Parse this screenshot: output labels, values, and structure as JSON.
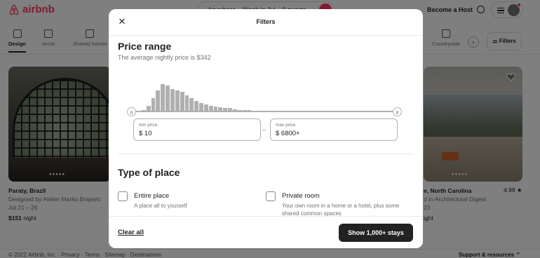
{
  "header": {
    "logo_text": "airbnb",
    "search": {
      "anywhere": "Anywhere",
      "week": "Week in Jul",
      "guests": "2 guests"
    },
    "become_host": "Become a Host",
    "brand_color": "#ff385c"
  },
  "categories": {
    "items": [
      {
        "label": "Design",
        "icon": "design-icon",
        "active": true
      },
      {
        "label": "Arctic",
        "icon": "snowflake-icon",
        "active": false
      },
      {
        "label": "Shared homes",
        "icon": "house-icon",
        "active": false
      },
      {
        "label": "Countryside",
        "icon": "tree-icon",
        "active": false
      }
    ],
    "filters_label": "Filters"
  },
  "listings": [
    {
      "title": "Paraty, Brazil",
      "subtitle": "Designed by Atelier Marko Brajovic",
      "dates": "Jul 21 – 26",
      "price": "$151",
      "price_unit": "night"
    },
    {
      "title": "e, North Carolina",
      "subtitle": "d in Architectural Digest",
      "dates": "23",
      "price_unit": "ight",
      "rating": "4.99 ★"
    }
  ],
  "footer": {
    "left": "© 2022 Airbnb, Inc.  ·  Privacy  ·  Terms  ·  Sitemap  ·  Destinations",
    "right": "Support & resources ⌃"
  },
  "modal": {
    "title": "Filters",
    "price_range": {
      "heading": "Price range",
      "subtitle": "The average nightly price is $342",
      "histogram": [
        2,
        3,
        8,
        18,
        28,
        36,
        34,
        30,
        28,
        26,
        22,
        18,
        14,
        12,
        10,
        8,
        7,
        6,
        5,
        5,
        4,
        3,
        3,
        3,
        2,
        2,
        2,
        2,
        2,
        2,
        1,
        1,
        1,
        1,
        1,
        1,
        1,
        1,
        1,
        1,
        1,
        1,
        1,
        1,
        1,
        1,
        1,
        1,
        1,
        1,
        1,
        1,
        1,
        1
      ],
      "histogram_color": "#b0b0b0",
      "min": {
        "label": "min price",
        "value": "$  10"
      },
      "max": {
        "label": "max price",
        "value": "$  6800+"
      },
      "separator": "–"
    },
    "type_of_place": {
      "heading": "Type of place",
      "options": [
        {
          "label": "Entire place",
          "desc": "A place all to yourself"
        },
        {
          "label": "Private room",
          "desc": "Your own room in a home or a hotel, plus some shared common spaces"
        }
      ]
    },
    "footer": {
      "clear_label": "Clear all",
      "show_label": "Show 1,000+ stays"
    }
  }
}
